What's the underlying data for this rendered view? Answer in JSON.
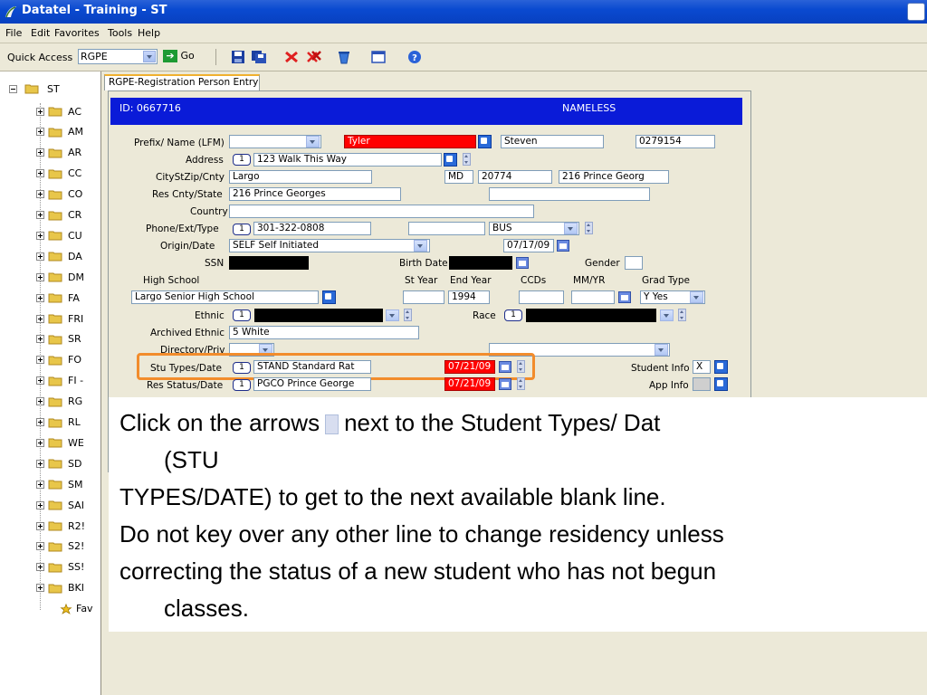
{
  "window": {
    "title": "Datatel - Training - ST"
  },
  "menu": [
    "File",
    "Edit",
    "Favorites",
    "Tools",
    "Help"
  ],
  "toolbar": {
    "quick_access_label": "Quick Access",
    "quick_access_value": "RGPE",
    "go_label": "Go"
  },
  "tree": {
    "root": "ST",
    "items": [
      "AC",
      "AM",
      "AR",
      "CC",
      "CO",
      "CR",
      "CU",
      "DA",
      "DM",
      "FA",
      "FRI",
      "SR",
      "FO",
      "FI -",
      "RG",
      "RL",
      "WE",
      "SD",
      "SM",
      "SAI",
      "R2!",
      "S2!",
      "SS!",
      "BKI",
      "Fav"
    ]
  },
  "tab": {
    "label": "RGPE-Registration Person Entry"
  },
  "header": {
    "id": "ID:  0667716",
    "name": "NAMELESS"
  },
  "form": {
    "prefix_label": "Prefix/ Name (LFM)",
    "last_name": "Tyler",
    "first_name": "Steven",
    "id_number": "0279154",
    "address_label": "Address",
    "address_num": "1",
    "address": "123 Walk This Way",
    "city_label": "CityStZip/Cnty",
    "city": "Largo",
    "state": "MD",
    "zip": "20774",
    "county": "216 Prince Georg",
    "res_cnty_label": "Res Cnty/State",
    "res_cnty": "216 Prince Georges",
    "country_label": "Country",
    "phone_label": "Phone/Ext/Type",
    "phone_num": "1",
    "phone": "301-322-0808",
    "phone_type": "BUS",
    "origin_label": "Origin/Date",
    "origin": "SELF Self Initiated",
    "origin_date": "07/17/09",
    "ssn_label": "SSN",
    "birth_label": "Birth Date",
    "gender_label": "Gender",
    "hs_label": "High School",
    "styear_label": "St Year",
    "endyear_label": "End Year",
    "ccds_label": "CCDs",
    "mmyr_label": "MM/YR",
    "gradtype_label": "Grad Type",
    "high_school": "Largo Senior High School",
    "end_year": "1994",
    "grad_type": "Y Yes",
    "ethnic_label": "Ethnic",
    "ethnic_num": "1",
    "race_label": "Race",
    "race_num": "1",
    "arch_ethnic_label": "Archived Ethnic",
    "arch_ethnic": "5 White",
    "directory_label": "Directory/Priv",
    "stu_types_label": "Stu Types/Date",
    "stu_types_num": "1",
    "stu_types": "STAND Standard Rat",
    "stu_types_date": "07/21/09",
    "student_info_label": "Student Info",
    "student_info": "X",
    "res_status_label": "Res Status/Date",
    "res_status_num": "1",
    "res_status": "PGCO Prince George",
    "res_status_date": "07/21/09",
    "app_info_label": "App Info"
  },
  "instruction": {
    "line1a": "Click on the arrows",
    "line1b": "next to the Student Types/ Dat",
    "line2": "(STU",
    "line3": "TYPES/DATE) to get to the next available blank line.",
    "line4": "Do not key over any other line to change residency unless",
    "line5": "correcting the status of a new student who has not begun",
    "line6": "classes."
  },
  "colors": {
    "header_blue": "#0a1bd8",
    "required_red": "#ff0000",
    "highlight_orange": "#f28c2c"
  }
}
